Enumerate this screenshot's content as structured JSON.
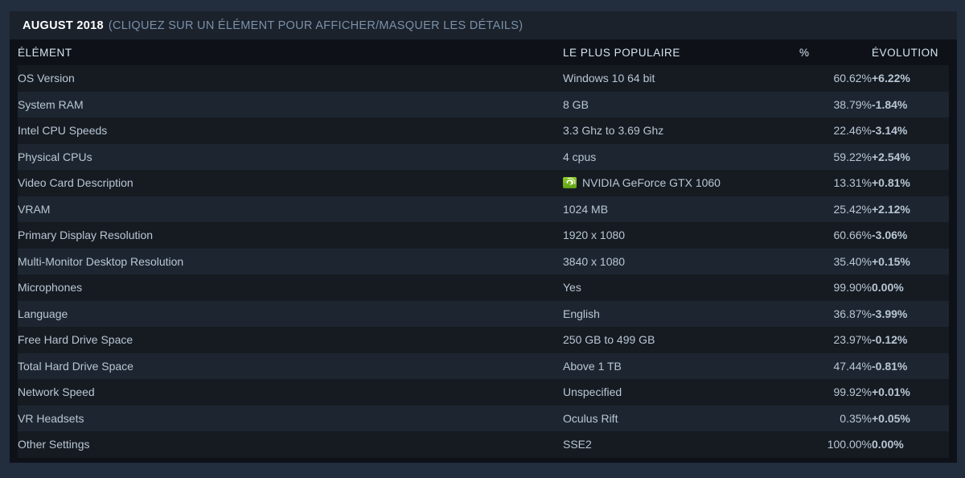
{
  "panel": {
    "header": {
      "month": "AUGUST 2018",
      "hint": "(CLIQUEZ SUR UN ÉLÉMENT POUR AFFICHER/MASQUER LES DÉTAILS)"
    },
    "columns": {
      "element": "ÉLÉMENT",
      "most_popular": "LE PLUS POPULAIRE",
      "percent": "%",
      "evolution": "ÉVOLUTION"
    },
    "rows": [
      {
        "element": "OS Version",
        "popular": "Windows 10 64 bit",
        "percent": "60.62%",
        "evolution": "+6.22%",
        "trend": "up",
        "icon": null
      },
      {
        "element": "System RAM",
        "popular": "8 GB",
        "percent": "38.79%",
        "evolution": "-1.84%",
        "trend": "down",
        "icon": null
      },
      {
        "element": "Intel CPU Speeds",
        "popular": "3.3 Ghz to 3.69 Ghz",
        "percent": "22.46%",
        "evolution": "-3.14%",
        "trend": "down",
        "icon": null
      },
      {
        "element": "Physical CPUs",
        "popular": "4 cpus",
        "percent": "59.22%",
        "evolution": "+2.54%",
        "trend": "up",
        "icon": null
      },
      {
        "element": "Video Card Description",
        "popular": "NVIDIA GeForce GTX 1060",
        "percent": "13.31%",
        "evolution": "+0.81%",
        "trend": "up",
        "icon": "nvidia-logo-icon"
      },
      {
        "element": "VRAM",
        "popular": "1024 MB",
        "percent": "25.42%",
        "evolution": "+2.12%",
        "trend": "up",
        "icon": null
      },
      {
        "element": "Primary Display Resolution",
        "popular": "1920 x 1080",
        "percent": "60.66%",
        "evolution": "-3.06%",
        "trend": "down",
        "icon": null
      },
      {
        "element": "Multi-Monitor Desktop Resolution",
        "popular": "3840 x 1080",
        "percent": "35.40%",
        "evolution": "+0.15%",
        "trend": "up",
        "icon": null
      },
      {
        "element": "Microphones",
        "popular": "Yes",
        "percent": "99.90%",
        "evolution": "0.00%",
        "trend": "flat",
        "icon": null
      },
      {
        "element": "Language",
        "popular": "English",
        "percent": "36.87%",
        "evolution": "-3.99%",
        "trend": "down",
        "icon": null
      },
      {
        "element": "Free Hard Drive Space",
        "popular": "250 GB to 499 GB",
        "percent": "23.97%",
        "evolution": "-0.12%",
        "trend": "down",
        "icon": null
      },
      {
        "element": "Total Hard Drive Space",
        "popular": "Above 1 TB",
        "percent": "47.44%",
        "evolution": "-0.81%",
        "trend": "down",
        "icon": null
      },
      {
        "element": "Network Speed",
        "popular": "Unspecified",
        "percent": "99.92%",
        "evolution": "+0.01%",
        "trend": "up",
        "icon": null
      },
      {
        "element": "VR Headsets",
        "popular": "Oculus Rift",
        "percent": "0.35%",
        "evolution": "+0.05%",
        "trend": "up",
        "icon": null
      },
      {
        "element": "Other Settings",
        "popular": "SSE2",
        "percent": "100.00%",
        "evolution": "0.00%",
        "trend": "flat",
        "icon": null
      }
    ]
  },
  "colors": {
    "page_background": "#222d3d",
    "panel_background": "#0e1218",
    "header_bar": "#1b222c",
    "row_odd": "#161b22",
    "row_even": "#1d2630",
    "text_primary": "#b8c6d4",
    "text_header": "#d6e4f0",
    "accent_up": "#8fd421",
    "accent_down": "#d9682a"
  }
}
